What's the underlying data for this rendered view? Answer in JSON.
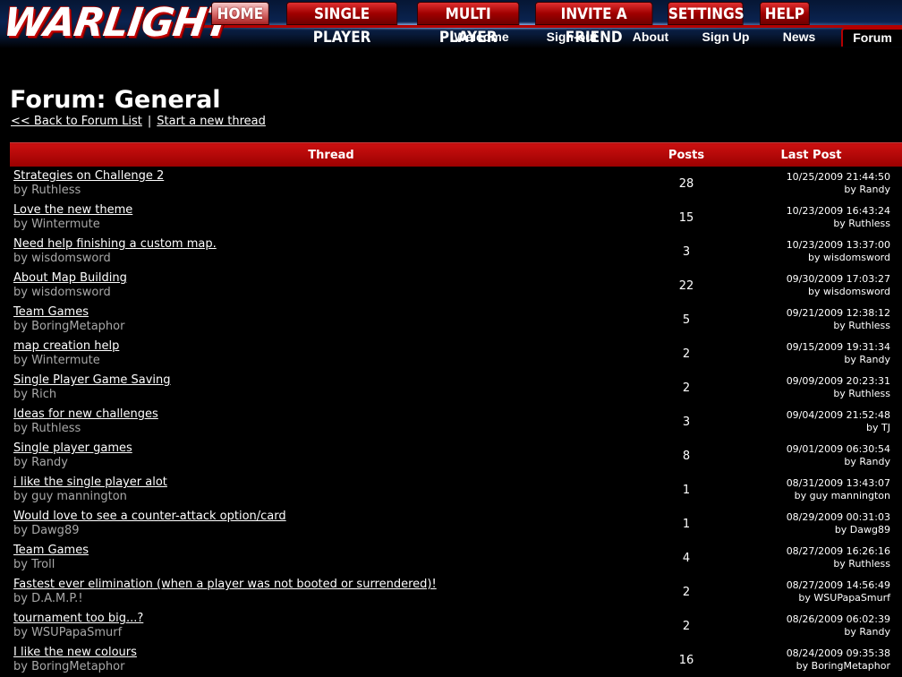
{
  "logo": "WARLIGHT",
  "topnav": [
    "HOME",
    "SINGLE PLAYER",
    "MULTI PLAYER",
    "INVITE A FRIEND",
    "SETTINGS",
    "HELP"
  ],
  "subnav": [
    "Welcome",
    "Sign-out",
    "About",
    "Sign Up",
    "News",
    "Forum"
  ],
  "page": {
    "title": "Forum: General",
    "back_link": "<< Back to Forum List",
    "separator": "|",
    "new_thread_link": "Start a new thread"
  },
  "table": {
    "headers": {
      "thread": "Thread",
      "posts": "Posts",
      "last_post": "Last Post"
    },
    "rows": [
      {
        "title": "Strategies on Challenge 2",
        "by": "by Ruthless",
        "posts": "28",
        "date": "10/25/2009 21:44:50",
        "last_by": "by Randy"
      },
      {
        "title": "Love the new theme",
        "by": "by Wintermute",
        "posts": "15",
        "date": "10/23/2009 16:43:24",
        "last_by": "by Ruthless"
      },
      {
        "title": "Need help finishing a custom map.",
        "by": "by wisdomsword",
        "posts": "3",
        "date": "10/23/2009 13:37:00",
        "last_by": "by wisdomsword"
      },
      {
        "title": "About Map Building",
        "by": "by wisdomsword",
        "posts": "22",
        "date": "09/30/2009 17:03:27",
        "last_by": "by wisdomsword"
      },
      {
        "title": "Team Games",
        "by": "by BoringMetaphor",
        "posts": "5",
        "date": "09/21/2009 12:38:12",
        "last_by": "by Ruthless"
      },
      {
        "title": "map creation help",
        "by": "by Wintermute",
        "posts": "2",
        "date": "09/15/2009 19:31:34",
        "last_by": "by Randy"
      },
      {
        "title": "Single Player Game Saving",
        "by": "by Rich",
        "posts": "2",
        "date": "09/09/2009 20:23:31",
        "last_by": "by Ruthless"
      },
      {
        "title": "Ideas for new challenges",
        "by": "by Ruthless",
        "posts": "3",
        "date": "09/04/2009 21:52:48",
        "last_by": "by TJ"
      },
      {
        "title": "Single player games",
        "by": "by Randy",
        "posts": "8",
        "date": "09/01/2009 06:30:54",
        "last_by": "by Randy"
      },
      {
        "title": "i like the single player alot",
        "by": "by guy mannington",
        "posts": "1",
        "date": "08/31/2009 13:43:07",
        "last_by": "by guy mannington"
      },
      {
        "title": "Would love to see a counter-attack option/card",
        "by": "by Dawg89",
        "posts": "1",
        "date": "08/29/2009 00:31:03",
        "last_by": "by Dawg89"
      },
      {
        "title": "Team Games",
        "by": "by Troll",
        "posts": "4",
        "date": "08/27/2009 16:26:16",
        "last_by": "by Ruthless"
      },
      {
        "title": "Fastest ever elimination (when a player was not booted or surrendered)!",
        "by": "by D.A.M.P.!",
        "posts": "2",
        "date": "08/27/2009 14:56:49",
        "last_by": "by WSUPapaSmurf"
      },
      {
        "title": "tournament too big...?",
        "by": "by WSUPapaSmurf",
        "posts": "2",
        "date": "08/26/2009 06:02:39",
        "last_by": "by Randy"
      },
      {
        "title": "I like the new colours",
        "by": "by BoringMetaphor",
        "posts": "16",
        "date": "08/24/2009 09:35:38",
        "last_by": "by BoringMetaphor"
      }
    ]
  }
}
